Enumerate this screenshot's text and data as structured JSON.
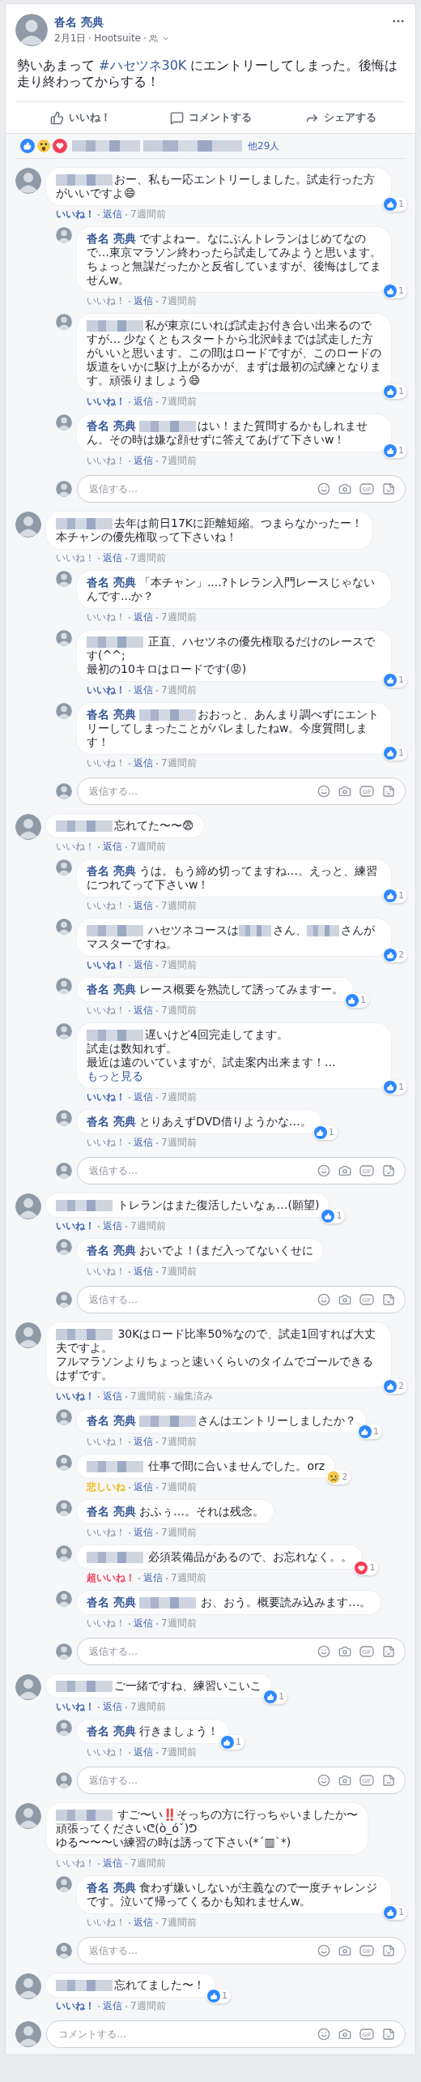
{
  "post": {
    "author": "沓名 亮典",
    "date": "2月1日",
    "via": "Hootsuite",
    "text": [
      {
        "kind": "text",
        "text": "勢いあまって "
      },
      {
        "kind": "link",
        "text": "#ハセツネ30K"
      },
      {
        "kind": "text",
        "text": " にエントリーしてしまった。後悔は走り終わってからする！"
      }
    ],
    "actions": [
      {
        "kind": "like",
        "label": "いいね！"
      },
      {
        "kind": "comment",
        "label": "コメントする"
      },
      {
        "kind": "share",
        "label": "シェアする"
      }
    ],
    "reactions": {
      "icons": [
        {
          "kind": "like"
        },
        {
          "kind": "wow"
        },
        {
          "kind": "love"
        }
      ],
      "others": "他29人"
    }
  },
  "comments": [
    {
      "parts": [
        {
          "kind": "blur"
        },
        {
          "kind": "text",
          "text": "おー、私も一応エントリーしました。試走行った方がいいですよ😄"
        }
      ],
      "like_link": {
        "kind": "like",
        "label": "いいね！"
      },
      "reply_label": "返信",
      "time": "7週間前",
      "badge": {
        "kind": "like",
        "count": "1"
      },
      "replies": [
        {
          "author": "沓名 亮典",
          "parts": [
            {
              "kind": "text",
              "text": "ですよねー。なにぶんトレランはじめてなので…東京マラソン終わったら試走してみようと思います。ちょっと無謀だったかと反省していますが、後悔はしてませんw。"
            }
          ],
          "like_link": {
            "kind": "plain",
            "label": "いいね！"
          },
          "reply_label": "返信",
          "time": "7週間前",
          "badge": {
            "kind": "like",
            "count": "1"
          }
        },
        {
          "parts": [
            {
              "kind": "blur"
            },
            {
              "kind": "text",
              "text": "私が東京にいれば試走お付き合い出来るのですが… 少なくともスタートから北沢峠までは試走した方がいいと思います。この間はロードですが、このロードの坂道をいかに駆け上がるかが、まずは最初の試練となります。頑張りましょう😄"
            }
          ],
          "like_link": {
            "kind": "like",
            "label": "いいね！"
          },
          "reply_label": "返信",
          "time": "7週間前",
          "badge": {
            "kind": "like",
            "count": "1"
          }
        },
        {
          "author": "沓名 亮典",
          "parts": [
            {
              "kind": "blur"
            },
            {
              "kind": "text",
              "text": "はい！また質問するかもしれません。その時は嫌な顔せずに答えてあげて下さいw！"
            }
          ],
          "like_link": {
            "kind": "plain",
            "label": "いいね！"
          },
          "reply_label": "返信",
          "time": "7週間前",
          "badge": {
            "kind": "like",
            "count": "1"
          }
        }
      ],
      "reply_box": {
        "placeholder": "返信する…",
        "gif_label": "GIF"
      }
    },
    {
      "parts": [
        {
          "kind": "blur"
        },
        {
          "kind": "text",
          "text": "去年は前日17Kに距離短縮。つまらなかったー！"
        },
        {
          "kind": "break"
        },
        {
          "kind": "text",
          "text": "本チャンの優先権取って下さいね！"
        }
      ],
      "like_link": {
        "kind": "plain",
        "label": "いいね！"
      },
      "reply_label": "返信",
      "time": "7週間前",
      "replies": [
        {
          "author": "沓名 亮典",
          "parts": [
            {
              "kind": "text",
              "text": "「本チャン」....?トレラン入門レースじゃないんです...か？"
            }
          ],
          "like_link": {
            "kind": "plain",
            "label": "いいね！"
          },
          "reply_label": "返信",
          "time": "7週間前"
        },
        {
          "parts": [
            {
              "kind": "blur"
            },
            {
              "kind": "text",
              "text": " 正直、ハセツネの優先権取るだけのレースです(^^;"
            },
            {
              "kind": "break"
            },
            {
              "kind": "text",
              "text": "最初の10キロはロードです(😡)"
            }
          ],
          "like_link": {
            "kind": "like",
            "label": "いいね！"
          },
          "reply_label": "返信",
          "time": "7週間前",
          "badge": {
            "kind": "like",
            "count": "1"
          }
        },
        {
          "author": "沓名 亮典",
          "parts": [
            {
              "kind": "blur"
            },
            {
              "kind": "text",
              "text": "おおっと、あんまり調べずにエントリーしてしまったことがバレましたねw。今度質問します！"
            }
          ],
          "like_link": {
            "kind": "plain",
            "label": "いいね！"
          },
          "reply_label": "返信",
          "time": "7週間前",
          "badge": {
            "kind": "like",
            "count": "1"
          }
        }
      ],
      "reply_box": {
        "placeholder": "返信する…",
        "gif_label": "GIF"
      }
    },
    {
      "parts": [
        {
          "kind": "blur"
        },
        {
          "kind": "text",
          "text": "忘れてた〜〜😨"
        }
      ],
      "like_link": {
        "kind": "plain",
        "label": "いいね！"
      },
      "reply_label": "返信",
      "time": "7週間前",
      "replies": [
        {
          "author": "沓名 亮典",
          "parts": [
            {
              "kind": "text",
              "text": "うは。もう締め切ってますね…。えっと、練習につれてって下さいw！"
            }
          ],
          "like_link": {
            "kind": "plain",
            "label": "いいね！"
          },
          "reply_label": "返信",
          "time": "7週間前",
          "badge": {
            "kind": "like",
            "count": "1"
          }
        },
        {
          "parts": [
            {
              "kind": "blur"
            },
            {
              "kind": "text",
              "text": " ハセツネコースは"
            },
            {
              "kind": "blur"
            },
            {
              "kind": "text",
              "text": "さん、"
            },
            {
              "kind": "blur"
            },
            {
              "kind": "text",
              "text": "さんがマスターですね。"
            }
          ],
          "like_link": {
            "kind": "like",
            "label": "いいね！"
          },
          "reply_label": "返信",
          "time": "7週間前",
          "badge": {
            "kind": "like",
            "count": "2"
          }
        },
        {
          "author": "沓名 亮典",
          "parts": [
            {
              "kind": "text",
              "text": "レース概要を熟読して誘ってみますー。"
            }
          ],
          "like_link": {
            "kind": "plain",
            "label": "いいね！"
          },
          "reply_label": "返信",
          "time": "7週間前",
          "badge": {
            "kind": "like",
            "count": "1"
          }
        },
        {
          "parts": [
            {
              "kind": "blur"
            },
            {
              "kind": "text",
              "text": "遅いけど4回完走してます。"
            },
            {
              "kind": "break"
            },
            {
              "kind": "text",
              "text": "試走は数知れず。"
            },
            {
              "kind": "break"
            },
            {
              "kind": "text",
              "text": "最近は遠のいていますが、試走案内出来ます！... "
            },
            {
              "kind": "link",
              "text": "もっと見る"
            }
          ],
          "like_link": {
            "kind": "like",
            "label": "いいね！"
          },
          "reply_label": "返信",
          "time": "7週間前",
          "badge": {
            "kind": "like",
            "count": "1"
          }
        },
        {
          "author": "沓名 亮典",
          "parts": [
            {
              "kind": "text",
              "text": "とりあえずDVD借りようかな…。"
            }
          ],
          "like_link": {
            "kind": "plain",
            "label": "いいね！"
          },
          "reply_label": "返信",
          "time": "7週間前",
          "badge": {
            "kind": "like",
            "count": "1"
          }
        }
      ],
      "reply_box": {
        "placeholder": "返信する…",
        "gif_label": "GIF"
      }
    },
    {
      "parts": [
        {
          "kind": "blur"
        },
        {
          "kind": "text",
          "text": " トレランはまた復活したいなぁ…(願望)"
        }
      ],
      "like_link": {
        "kind": "like",
        "label": "いいね！"
      },
      "reply_label": "返信",
      "time": "7週間前",
      "badge": {
        "kind": "like",
        "count": "1"
      },
      "replies": [
        {
          "author": "沓名 亮典",
          "parts": [
            {
              "kind": "text",
              "text": "おいでよ！(まだ入ってないくせに"
            }
          ],
          "like_link": {
            "kind": "plain",
            "label": "いいね！"
          },
          "reply_label": "返信",
          "time": "7週間前"
        }
      ],
      "reply_box": {
        "placeholder": "返信する…",
        "gif_label": "GIF"
      }
    },
    {
      "parts": [
        {
          "kind": "blur"
        },
        {
          "kind": "text",
          "text": " 30Kはロード比率50%なので、試走1回すれば大丈夫ですよ。"
        },
        {
          "kind": "break"
        },
        {
          "kind": "text",
          "text": "フルマラソンよりちょっと速いくらいのタイムでゴールできるはずです。"
        }
      ],
      "like_link": {
        "kind": "like",
        "label": "いいね！"
      },
      "reply_label": "返信",
      "time": "7週間前",
      "edited": "編集済み",
      "badge": {
        "kind": "like",
        "count": "2"
      },
      "replies": [
        {
          "author": "沓名 亮典",
          "parts": [
            {
              "kind": "blur"
            },
            {
              "kind": "text",
              "text": "さんはエントリーしましたか？"
            }
          ],
          "like_link": {
            "kind": "plain",
            "label": "いいね！"
          },
          "reply_label": "返信",
          "time": "7週間前",
          "badge": {
            "kind": "like",
            "count": "1"
          }
        },
        {
          "parts": [
            {
              "kind": "blur"
            },
            {
              "kind": "text",
              "text": " 仕事で間に合いませんでした。orz"
            }
          ],
          "like_link": {
            "kind": "sad",
            "label": "悲しいね"
          },
          "reply_label": "返信",
          "time": "7週間前",
          "badge": {
            "kind": "sad",
            "count": "2"
          }
        },
        {
          "author": "沓名 亮典",
          "parts": [
            {
              "kind": "text",
              "text": "おふぅ…。それは残念。"
            }
          ],
          "like_link": {
            "kind": "plain",
            "label": "いいね！"
          },
          "reply_label": "返信",
          "time": "7週間前"
        },
        {
          "parts": [
            {
              "kind": "blur"
            },
            {
              "kind": "text",
              "text": " 必須装備品があるので、お忘れなく。。"
            }
          ],
          "like_link": {
            "kind": "love",
            "label": "超いいね！"
          },
          "reply_label": "返信",
          "time": "7週間前",
          "badge": {
            "kind": "love",
            "count": "1"
          }
        },
        {
          "author": "沓名 亮典",
          "parts": [
            {
              "kind": "blur"
            },
            {
              "kind": "text",
              "text": " お、おう。概要読み込みます…。"
            }
          ],
          "like_link": {
            "kind": "plain",
            "label": "いいね！"
          },
          "reply_label": "返信",
          "time": "7週間前"
        }
      ],
      "reply_box": {
        "placeholder": "返信する…",
        "gif_label": "GIF"
      }
    },
    {
      "parts": [
        {
          "kind": "blur"
        },
        {
          "kind": "text",
          "text": "ご一緒ですね、練習いこいこ"
        }
      ],
      "like_link": {
        "kind": "like",
        "label": "いいね！"
      },
      "reply_label": "返信",
      "time": "7週間前",
      "badge": {
        "kind": "like",
        "count": "1"
      },
      "replies": [
        {
          "author": "沓名 亮典",
          "parts": [
            {
              "kind": "text",
              "text": "行きましょう！"
            }
          ],
          "like_link": {
            "kind": "plain",
            "label": "いいね！"
          },
          "reply_label": "返信",
          "time": "7週間前",
          "badge": {
            "kind": "like",
            "count": "1"
          }
        }
      ],
      "reply_box": {
        "placeholder": "返信する…",
        "gif_label": "GIF"
      }
    },
    {
      "parts": [
        {
          "kind": "blur"
        },
        {
          "kind": "text",
          "text": " すご〜い‼️そっちの方に行っちゃいましたか〜"
        },
        {
          "kind": "break"
        },
        {
          "kind": "text",
          "text": "頑張ってくださいᕦ(ò_óˇ)ᕤ"
        },
        {
          "kind": "break"
        },
        {
          "kind": "text",
          "text": "ゆる〜〜〜い練習の時は誘って下さい(*´▥`*)"
        }
      ],
      "like_link": {
        "kind": "plain",
        "label": "いいね！"
      },
      "reply_label": "返信",
      "time": "7週間前",
      "replies": [
        {
          "author": "沓名 亮典",
          "parts": [
            {
              "kind": "text",
              "text": "食わず嫌いしないが主義なので一度チャレンジです。泣いて帰ってくるかも知れませんw。"
            }
          ],
          "like_link": {
            "kind": "plain",
            "label": "いいね！"
          },
          "reply_label": "返信",
          "time": "7週間前",
          "badge": {
            "kind": "like",
            "count": "1"
          }
        }
      ],
      "reply_box": {
        "placeholder": "返信する…",
        "gif_label": "GIF"
      }
    },
    {
      "parts": [
        {
          "kind": "blur"
        },
        {
          "kind": "text",
          "text": "忘れてました〜！"
        }
      ],
      "like_link": {
        "kind": "like",
        "label": "いいね！"
      },
      "reply_label": "返信",
      "time": "7週間前",
      "badge": {
        "kind": "like",
        "count": "1"
      }
    }
  ],
  "comment_box": {
    "placeholder": "コメントする…",
    "gif_label": "GIF"
  }
}
